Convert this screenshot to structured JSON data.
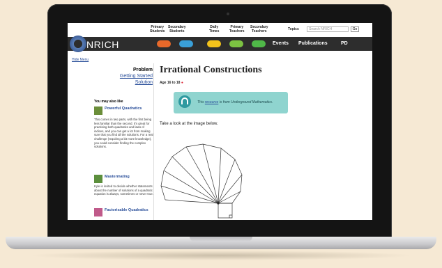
{
  "nav": {
    "items": [
      {
        "line1": "Primary",
        "line2": "Students"
      },
      {
        "line1": "Secondary",
        "line2": "Students"
      },
      {
        "line1": "Daily",
        "line2": "Times"
      },
      {
        "line1": "Primary",
        "line2": "Teachers"
      },
      {
        "line1": "Secondary",
        "line2": "Teachers"
      }
    ],
    "topics_label": "Topics",
    "search_placeholder": "Search NRICH",
    "go_label": "Go"
  },
  "header": {
    "logo_text": "NRICH",
    "pill_colors": [
      "#e8692a",
      "#3aa0d8",
      "#f2c21b",
      "#7cc242",
      "#4fb848"
    ],
    "links": [
      "Events",
      "Publications",
      "PD"
    ]
  },
  "sidebar": {
    "hide_menu": "Hide Menu",
    "problem_heading": "Problem",
    "getting_started": "Getting Started",
    "solution": "Solution",
    "you_may_also_like": "You may also like",
    "cards": [
      {
        "title": "Powerful Quadratics",
        "text": "This comes in two parts, with the first being less familiar than the second. It's great for practising both quadratics and laws of indices, and you can get a lot from making sure that you find all the solutions. For a real challenge (requiring a bit more knowledge), you could consider finding the complex solutions.",
        "icon_color": "#6b8e3a"
      },
      {
        "title": "Mastermating",
        "text": "Kyle is invited to decide whether statements about the number of solutions of a quadratic equation is always, sometimes or never true.",
        "icon_color": "#5c8f3d"
      },
      {
        "title": "Factorisable Quadratics",
        "text": "",
        "icon_color": "#c05a8a"
      }
    ]
  },
  "main": {
    "title": "Irrational Constructions",
    "age": "Age 16 to 18",
    "banner_pre": "This",
    "banner_link": "resource",
    "banner_post": "is from Underground Mathematics.",
    "instruction": "Take a look at the image below."
  },
  "colors": {
    "bar_bg": "#2d2d2d",
    "link": "#2a4f9a",
    "banner_bg": "#8fd4cf"
  }
}
